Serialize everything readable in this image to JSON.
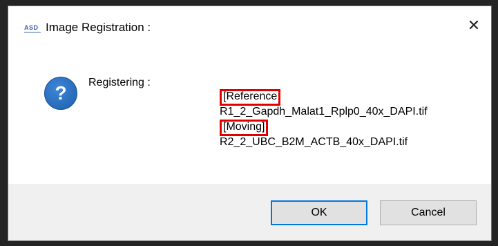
{
  "window": {
    "app_icon_text": "ASD",
    "title": "Image Registration :",
    "close_glyph": "✕"
  },
  "message": {
    "icon": "question-icon",
    "heading": "Registering :",
    "reference_tag": "[Reference",
    "reference_file": "R1_2_Gapdh_Malat1_Rplp0_40x_DAPI.tif",
    "moving_tag": "[Moving]",
    "moving_file": "R2_2_UBC_B2M_ACTB_40x_DAPI.tif"
  },
  "buttons": {
    "ok_label": "OK",
    "cancel_label": "Cancel"
  },
  "colors": {
    "highlight": "#e00000",
    "default_button_border": "#0078d7",
    "button_bar": "#f0f0f0"
  }
}
